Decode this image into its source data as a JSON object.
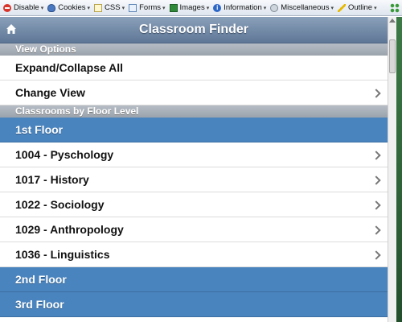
{
  "toolbar": {
    "items": [
      {
        "label": "Disable",
        "icon": "disable-icon"
      },
      {
        "label": "Cookies",
        "icon": "cookies-icon"
      },
      {
        "label": "CSS",
        "icon": "css-icon"
      },
      {
        "label": "Forms",
        "icon": "forms-icon"
      },
      {
        "label": "Images",
        "icon": "images-icon"
      },
      {
        "label": "Information",
        "icon": "information-icon"
      },
      {
        "label": "Miscellaneous",
        "icon": "miscellaneous-icon"
      },
      {
        "label": "Outline",
        "icon": "outline-icon"
      }
    ]
  },
  "header": {
    "title": "Classroom Finder",
    "home_icon": "home-icon"
  },
  "view_options": {
    "heading": "View Options",
    "items": [
      {
        "label": "Expand/Collapse All"
      },
      {
        "label": "Change View"
      }
    ]
  },
  "classrooms": {
    "heading": "Classrooms by Floor Level",
    "floors": [
      {
        "label": "1st Floor"
      },
      {
        "label": "2nd Floor"
      },
      {
        "label": "3rd Floor"
      }
    ],
    "rooms": [
      {
        "label": "1004 - Pyschology"
      },
      {
        "label": "1017 - History"
      },
      {
        "label": "1022 - Sociology"
      },
      {
        "label": "1029 - Anthropology"
      },
      {
        "label": "1036 - Linguistics"
      }
    ]
  },
  "colors": {
    "header": "#6e86a6",
    "floor_row": "#4a84be",
    "divider": "#a7afb8"
  }
}
